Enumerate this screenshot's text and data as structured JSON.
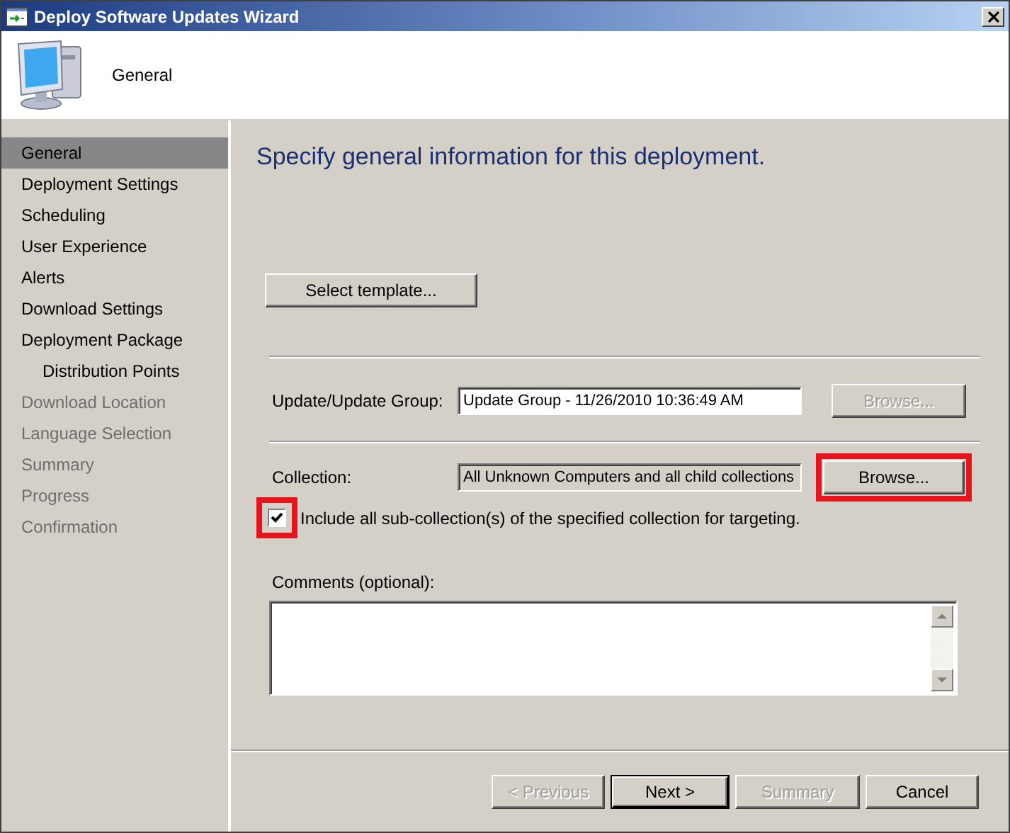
{
  "window": {
    "title": "Deploy Software Updates Wizard"
  },
  "header": {
    "page_title": "General"
  },
  "sidebar": {
    "items": [
      {
        "label": "General",
        "selected": true,
        "disabled": false
      },
      {
        "label": "Deployment Settings",
        "selected": false,
        "disabled": false
      },
      {
        "label": "Scheduling",
        "selected": false,
        "disabled": false
      },
      {
        "label": "User Experience",
        "selected": false,
        "disabled": false
      },
      {
        "label": "Alerts",
        "selected": false,
        "disabled": false
      },
      {
        "label": "Download Settings",
        "selected": false,
        "disabled": false
      },
      {
        "label": "Deployment Package",
        "selected": false,
        "disabled": false,
        "children": [
          {
            "label": "Distribution Points",
            "selected": false,
            "disabled": false
          }
        ]
      },
      {
        "label": "Download Location",
        "selected": false,
        "disabled": true
      },
      {
        "label": "Language Selection",
        "selected": false,
        "disabled": true
      },
      {
        "label": "Summary",
        "selected": false,
        "disabled": true
      },
      {
        "label": "Progress",
        "selected": false,
        "disabled": true
      },
      {
        "label": "Confirmation",
        "selected": false,
        "disabled": true
      }
    ]
  },
  "main": {
    "heading": "Specify general information for this deployment.",
    "template_button": {
      "label": "Select template...",
      "disabled": false
    },
    "update_group": {
      "label": "Update/Update Group:",
      "value": "Update Group - 11/26/2010 10:36:49 AM",
      "readonly": false,
      "browse": {
        "label": "Browse...",
        "disabled": true,
        "highlighted": false
      }
    },
    "collection": {
      "label": "Collection:",
      "value": "All Unknown Computers and all child collections",
      "readonly": true,
      "browse": {
        "label": "Browse...",
        "disabled": false,
        "highlighted": true
      }
    },
    "include_subcollections": {
      "label": "Include all sub-collection(s) of the specified collection for targeting.",
      "checked": true,
      "highlighted": true
    },
    "comments": {
      "label": "Comments (optional):"
    }
  },
  "buttons": [
    {
      "label": "< Previous",
      "disabled": true,
      "default": false
    },
    {
      "label": "Next >",
      "disabled": false,
      "default": true
    },
    {
      "label": "Summary",
      "disabled": true,
      "default": false
    },
    {
      "label": "Cancel",
      "disabled": false,
      "default": false
    }
  ]
}
